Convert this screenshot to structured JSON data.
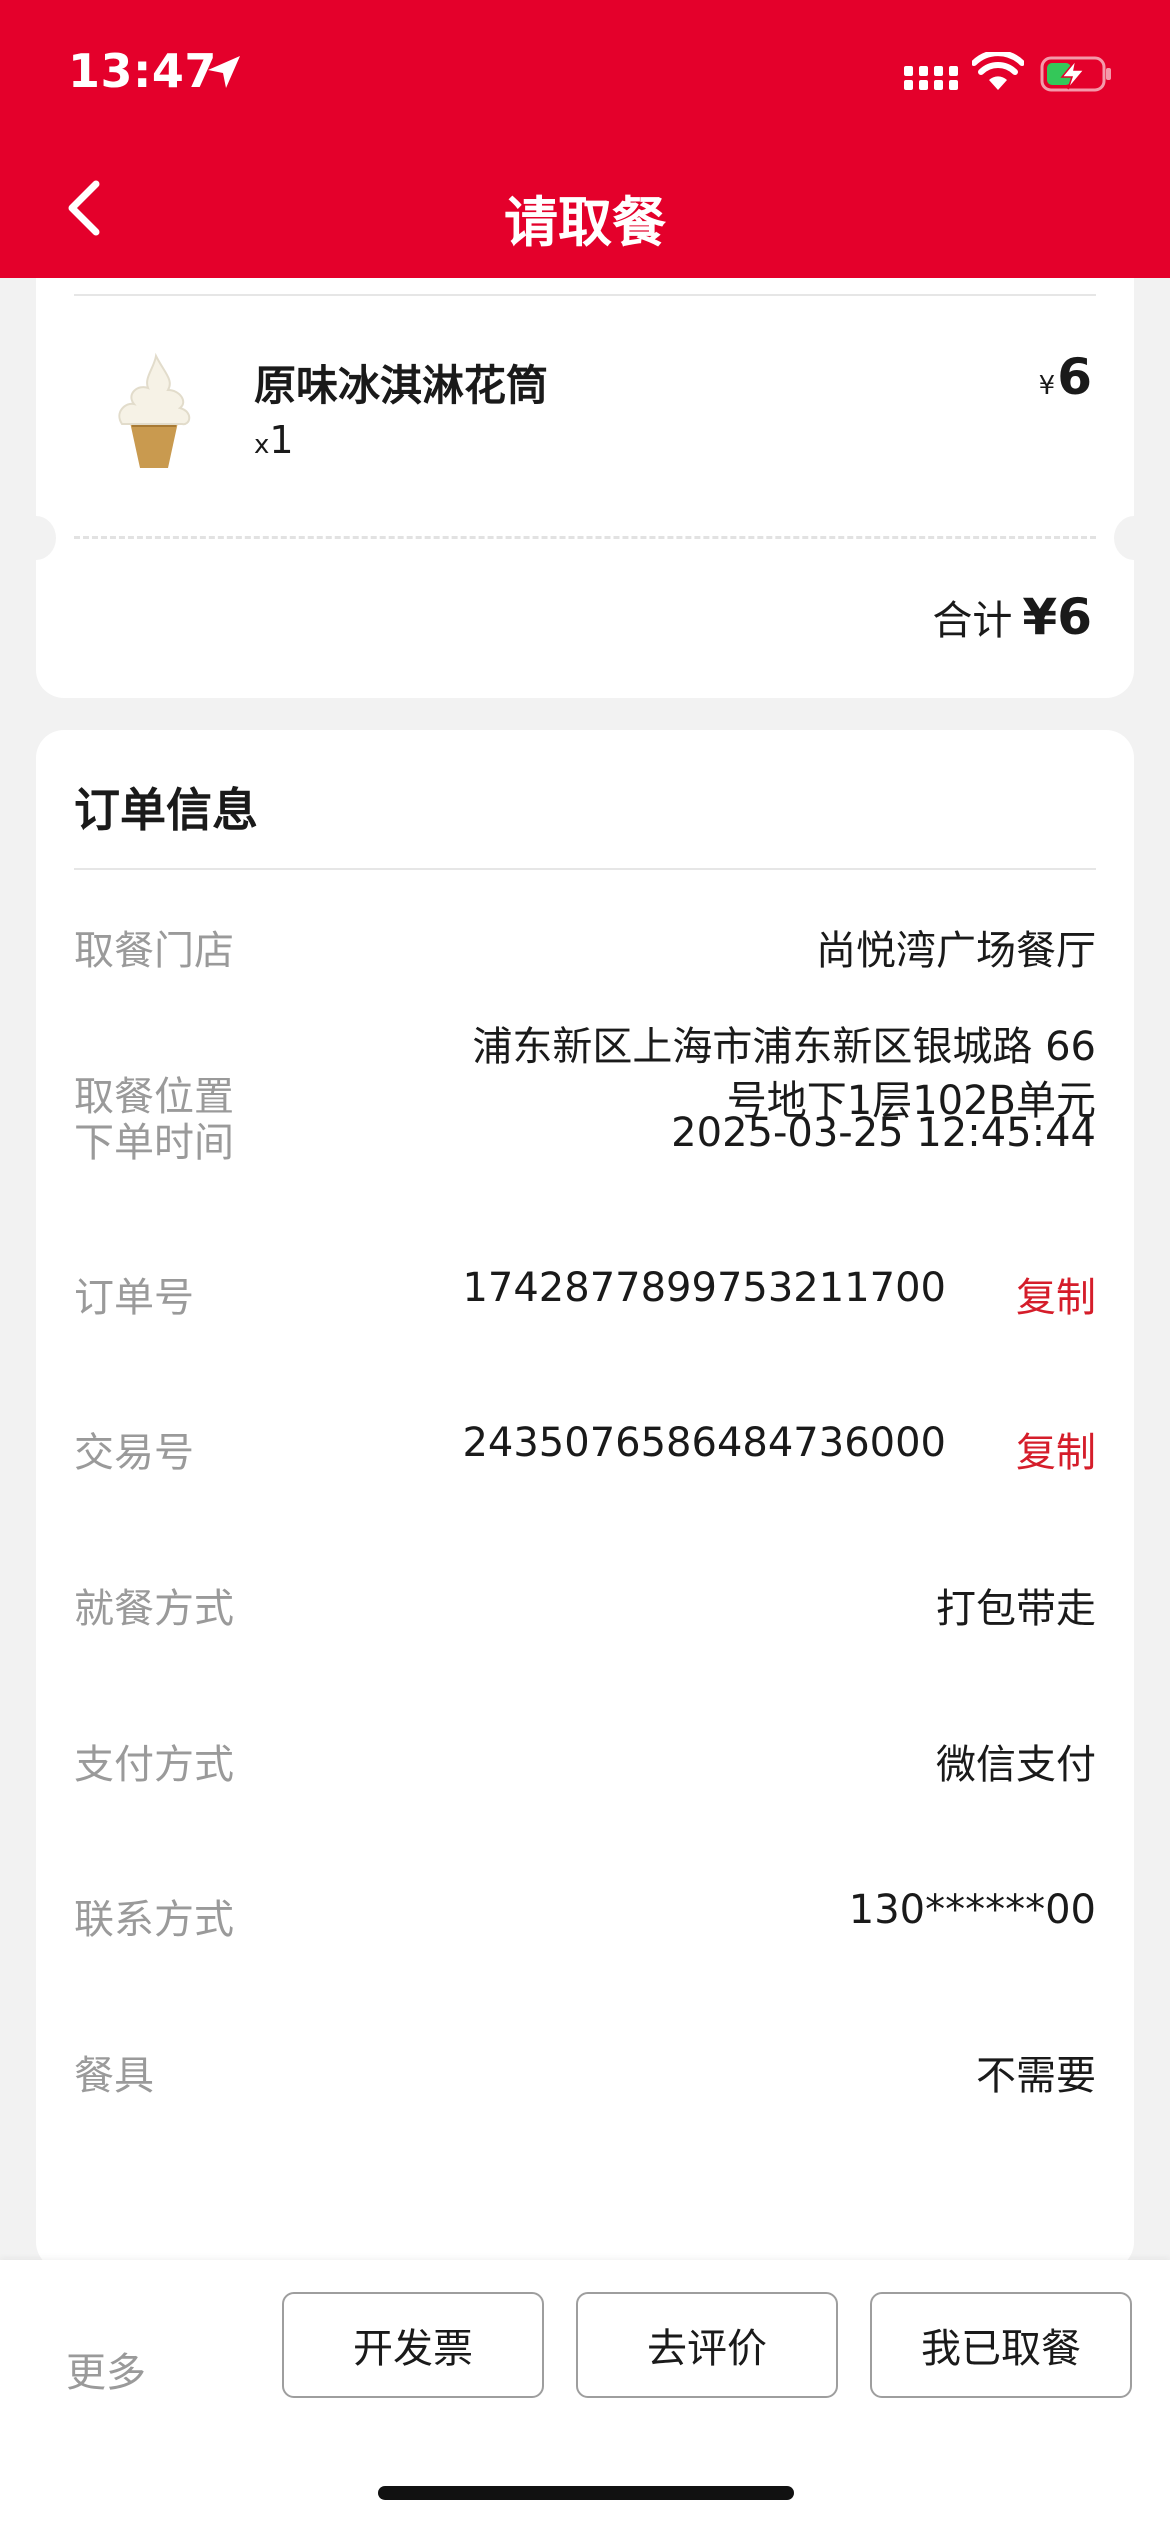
{
  "status_bar": {
    "time": "13:47"
  },
  "header": {
    "title": "请取餐"
  },
  "item": {
    "name": "原味冰淇淋花筒",
    "qty_prefix": "x",
    "qty": "1",
    "currency": "¥",
    "price": "6",
    "total_label": "合计",
    "total_value": "¥6"
  },
  "order_info": {
    "title": "订单信息",
    "rows": [
      {
        "label": "取餐门店",
        "value": "尚悦湾广场餐厅"
      },
      {
        "label": "取餐位置",
        "value_line1": "浦东新区上海市浦东新区银城路 66",
        "value_line2": "号地下1层102B单元"
      },
      {
        "label": "下单时间",
        "value": "2025-03-25 12:45:44"
      },
      {
        "label": "订单号",
        "value": "1742877899753211700",
        "action": "复制"
      },
      {
        "label": "交易号",
        "value": "2435076586484736000",
        "action": "复制"
      },
      {
        "label": "就餐方式",
        "value": "打包带走"
      },
      {
        "label": "支付方式",
        "value": "微信支付"
      },
      {
        "label": "联系方式",
        "value": "130******00"
      },
      {
        "label": "餐具",
        "value": "不需要"
      }
    ]
  },
  "bottom_bar": {
    "more": "更多",
    "invoice": "开发票",
    "review": "去评价",
    "picked_up": "我已取餐"
  },
  "colors": {
    "brand": "#e4002b",
    "action": "#d51d2a"
  }
}
